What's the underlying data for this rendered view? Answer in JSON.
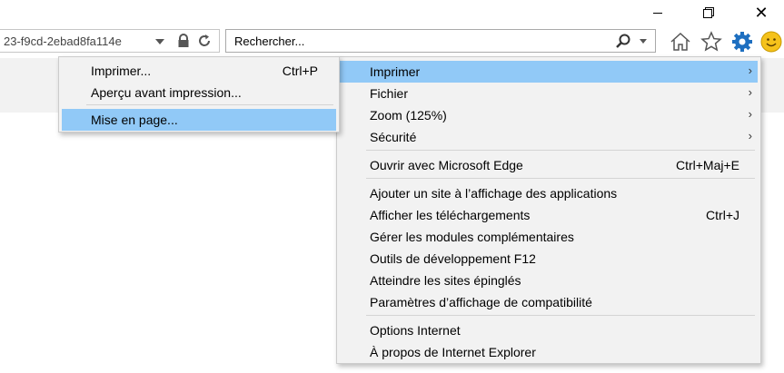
{
  "address": {
    "url": "23-f9cd-2ebad8fa114e"
  },
  "search": {
    "placeholder": "Rechercher..."
  },
  "window": {
    "close": "✕"
  },
  "main_menu": {
    "items": [
      {
        "label": "Imprimer",
        "submenu": true,
        "highlighted": true
      },
      {
        "label": "Fichier",
        "submenu": true
      },
      {
        "label": "Zoom (125%)",
        "submenu": true
      },
      {
        "label": "Sécurité",
        "submenu": true
      },
      {
        "label": "Ouvrir avec Microsoft Edge",
        "shortcut": "Ctrl+Maj+E"
      },
      {
        "label": "Ajouter un site à l’affichage des applications"
      },
      {
        "label": "Afficher les téléchargements",
        "shortcut": "Ctrl+J"
      },
      {
        "label": "Gérer les modules complémentaires"
      },
      {
        "label": "Outils de développement F12"
      },
      {
        "label": "Atteindre les sites épinglés"
      },
      {
        "label": "Paramètres d’affichage de compatibilité"
      },
      {
        "label": "Options Internet"
      },
      {
        "label": "À propos de Internet Explorer"
      }
    ],
    "arrow": "›"
  },
  "sub_menu": {
    "items": [
      {
        "label": "Imprimer...",
        "shortcut": "Ctrl+P"
      },
      {
        "label": "Aperçu avant impression..."
      },
      {
        "label": "Mise en page...",
        "highlighted": true
      }
    ]
  },
  "colors": {
    "highlight": "#91c9f7",
    "menu_bg": "#f2f2f2",
    "gear": "#1e6fc0",
    "smiley": "#f5c21b"
  }
}
